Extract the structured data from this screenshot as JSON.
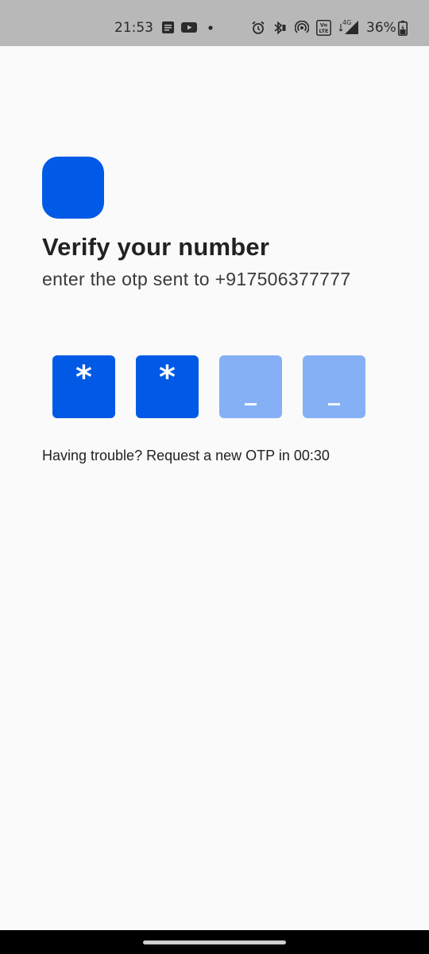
{
  "status_bar": {
    "time": "21:53",
    "battery_text": "36%",
    "network_badge": "4G",
    "volte_badge": "Vo LTE",
    "icons": [
      "message-icon",
      "youtube-icon",
      "dot-icon",
      "alarm-icon",
      "bluetooth-icon",
      "hotspot-icon",
      "volte-icon",
      "signal-icon",
      "battery-icon"
    ]
  },
  "logo": {
    "color": "#005ae6"
  },
  "title": "Verify your number",
  "subtitle": "enter the otp sent to +917506377777",
  "otp": {
    "boxes": [
      {
        "char": "*",
        "state": "filled"
      },
      {
        "char": "*",
        "state": "filled"
      },
      {
        "char": "_",
        "state": "empty"
      },
      {
        "char": "_",
        "state": "empty"
      }
    ],
    "filled_color": "#005ae6",
    "empty_color": "#85b0f5"
  },
  "resend": {
    "prefix": "Having trouble? ",
    "link_text": "Request a new OTP",
    "middle": " in ",
    "countdown": "00:30"
  }
}
